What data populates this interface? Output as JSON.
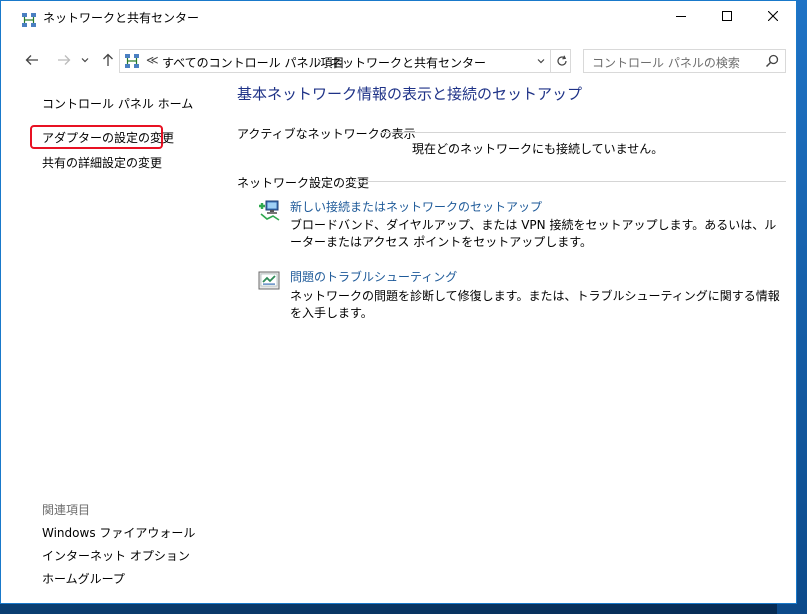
{
  "window": {
    "title": "ネットワークと共有センター"
  },
  "address_bar": {
    "overflow_marker": "≪",
    "breadcrumbs": [
      "すべてのコントロール パネル項目",
      "ネットワークと共有センター"
    ],
    "chevron": "›"
  },
  "search": {
    "placeholder": "コントロール パネルの検索"
  },
  "sidebar": {
    "home": "コントロール パネル ホーム",
    "adapter_settings": "アダプターの設定の変更",
    "advanced_sharing": "共有の詳細設定の変更",
    "see_also_heading": "関連項目",
    "see_also": [
      "Windows ファイアウォール",
      "インターネット オプション",
      "ホームグループ"
    ]
  },
  "main": {
    "title": "基本ネットワーク情報の表示と接続のセットアップ",
    "active_networks_heading": "アクティブなネットワークの表示",
    "no_connection_text": "現在どのネットワークにも接続していません。",
    "change_settings_heading": "ネットワーク設定の変更",
    "tasks": [
      {
        "icon": "new-connection-icon",
        "title": "新しい接続またはネットワークのセットアップ",
        "description": "ブロードバンド、ダイヤルアップ、または VPN 接続をセットアップします。あるいは、ルーターまたはアクセス ポイントをセットアップします。"
      },
      {
        "icon": "troubleshoot-icon",
        "title": "問題のトラブルシューティング",
        "description": "ネットワークの問題を診断して修復します。または、トラブルシューティングに関する情報を入手します。"
      }
    ]
  },
  "colors": {
    "link": "#1e5a99",
    "title": "#1e3287",
    "highlight": "#e81123",
    "window_border": "#1979ca"
  }
}
